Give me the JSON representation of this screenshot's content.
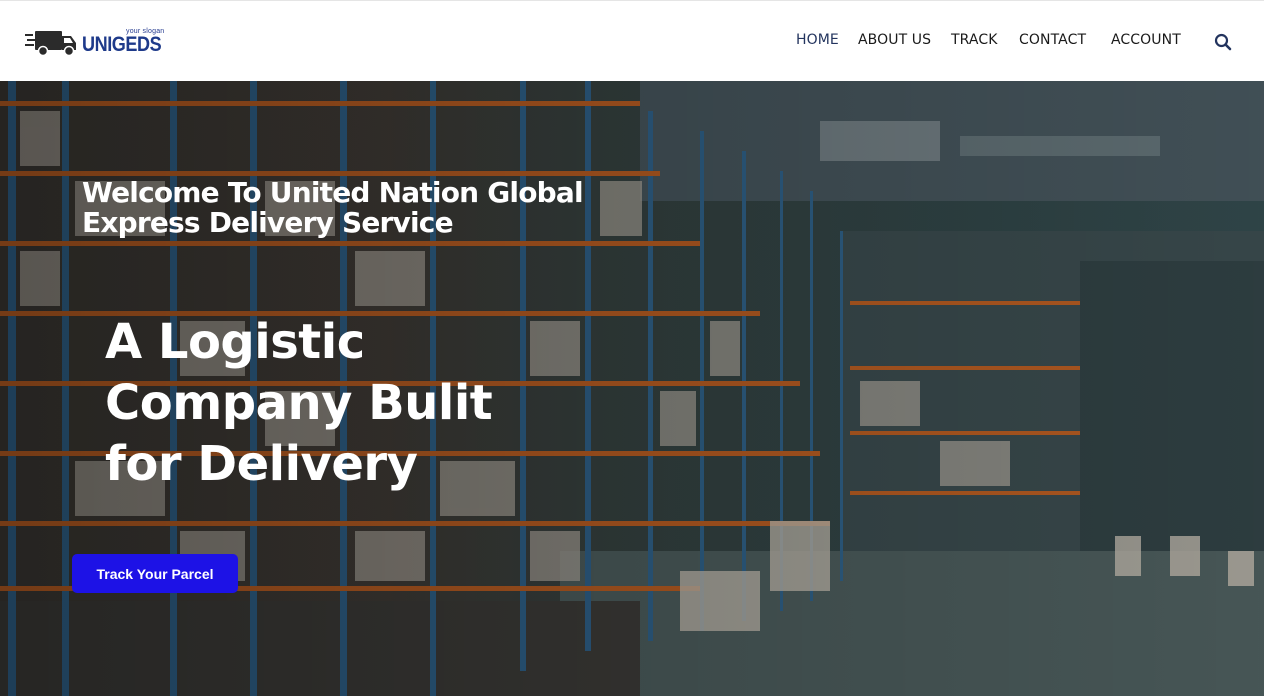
{
  "logo": {
    "name": "UNIGEDS",
    "slogan": "your slogan"
  },
  "nav": {
    "items": [
      {
        "label": "HOME",
        "active": true
      },
      {
        "label": "ABOUT US"
      },
      {
        "label": "TRACK"
      },
      {
        "label": "CONTACT"
      },
      {
        "label": "ACCOUNT"
      }
    ],
    "search_icon": "search-icon"
  },
  "hero": {
    "welcome": "Welcome To United Nation Global Express Delivery Service",
    "headline": "A Logistic Company Bulit for Delivery",
    "cta_label": "Track Your Parcel",
    "background": "warehouse-photo"
  },
  "colors": {
    "brand": "#1e3a8a",
    "cta": "#1d12e6",
    "nav_text": "#1a1a1a"
  }
}
